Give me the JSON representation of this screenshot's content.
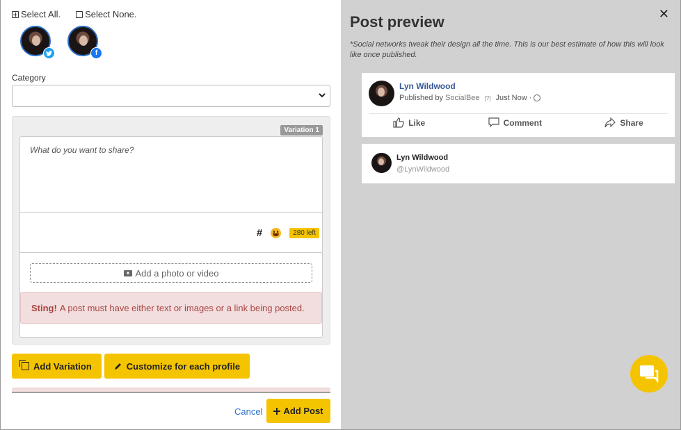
{
  "selection": {
    "select_all": "Select All.",
    "select_none": "Select None."
  },
  "profiles": [
    {
      "network": "twitter",
      "icon": "twitter-icon"
    },
    {
      "network": "facebook",
      "icon": "facebook-icon"
    }
  ],
  "category": {
    "label": "Category",
    "value": ""
  },
  "variation": {
    "tag": "Variation 1",
    "placeholder": "What do you want to share?",
    "hashtag_symbol": "#",
    "chars_left": "280 left",
    "add_media": "Add a photo or video",
    "alert_title": "Sting!",
    "alert_text": "A post must have either text or images or a link being posted."
  },
  "buttons": {
    "add_variation": "Add Variation",
    "customize": "Customize for each profile",
    "cancel": "Cancel",
    "add_post": "Add Post"
  },
  "preview": {
    "title": "Post preview",
    "note": "*Social networks tweak their design all the time. This is our best estimate of how this will look like once published.",
    "facebook": {
      "name": "Lyn Wildwood",
      "published_by": "Published by",
      "publisher": "SocialBee",
      "q_mark": "[?]",
      "time": "Just Now ·",
      "actions": [
        "Like",
        "Comment",
        "Share"
      ]
    },
    "twitter": {
      "name": "Lyn Wildwood",
      "handle": "@LynWildwood"
    }
  },
  "colors": {
    "accent": "#f5c400",
    "link": "#2b6fc5",
    "alert_bg": "#f2dede",
    "alert_text": "#a94442",
    "preview_bg": "#d1d1d1"
  }
}
